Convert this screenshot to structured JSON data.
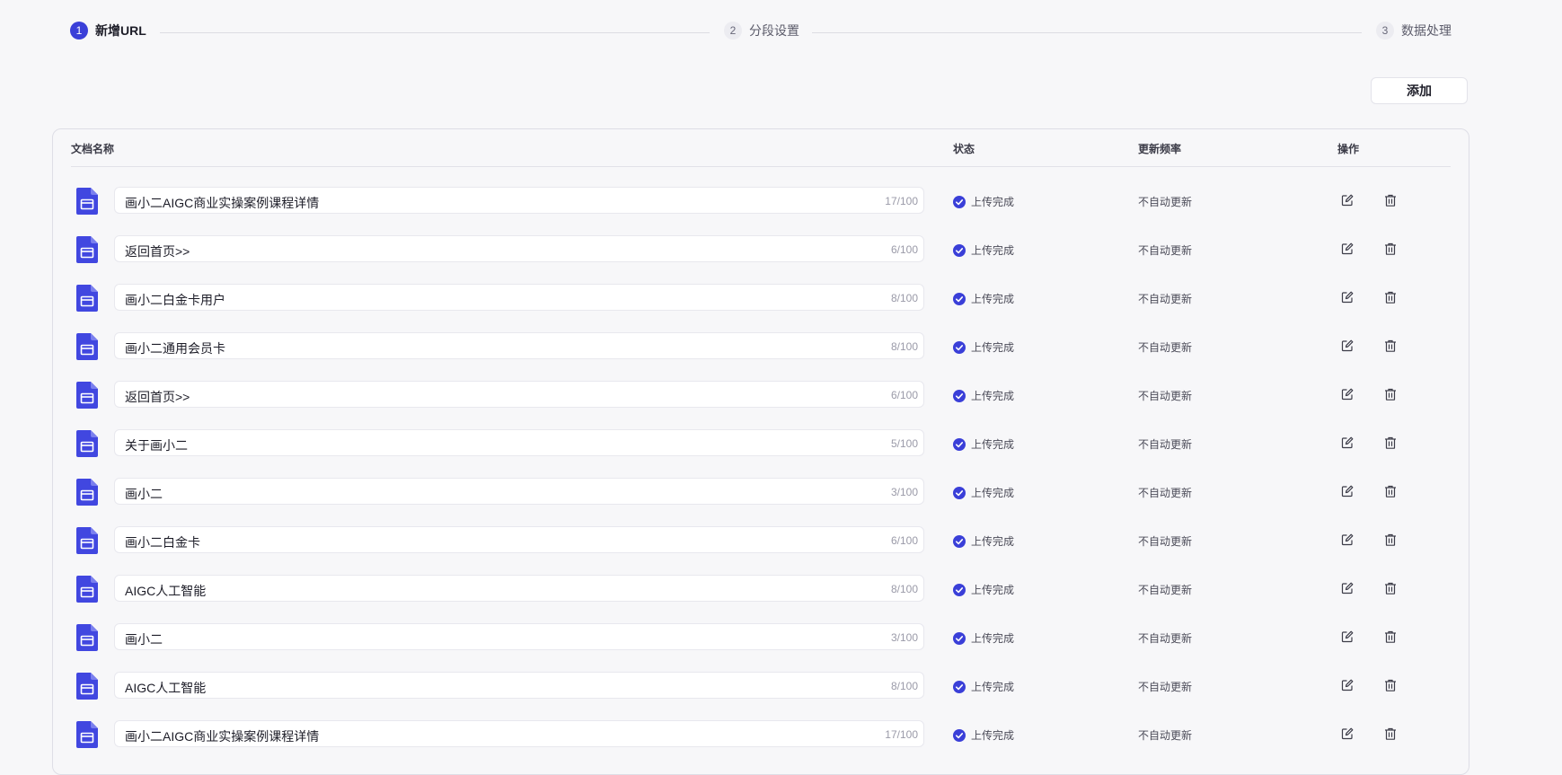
{
  "steps": [
    {
      "num": "1",
      "label": "新增URL"
    },
    {
      "num": "2",
      "label": "分段设置"
    },
    {
      "num": "3",
      "label": "数据处理"
    }
  ],
  "add_button": "添加",
  "table": {
    "headers": {
      "name": "文档名称",
      "status": "状态",
      "frequency": "更新频率",
      "actions": "操作"
    },
    "rows": [
      {
        "name": "画小二AIGC商业实操案例课程详情",
        "count": "17/100",
        "status": "上传完成",
        "frequency": "不自动更新"
      },
      {
        "name": "返回首页>>",
        "count": "6/100",
        "status": "上传完成",
        "frequency": "不自动更新"
      },
      {
        "name": "画小二白金卡用户",
        "count": "8/100",
        "status": "上传完成",
        "frequency": "不自动更新"
      },
      {
        "name": "画小二通用会员卡",
        "count": "8/100",
        "status": "上传完成",
        "frequency": "不自动更新"
      },
      {
        "name": "返回首页>>",
        "count": "6/100",
        "status": "上传完成",
        "frequency": "不自动更新"
      },
      {
        "name": "关于画小二",
        "count": "5/100",
        "status": "上传完成",
        "frequency": "不自动更新"
      },
      {
        "name": "画小二",
        "count": "3/100",
        "status": "上传完成",
        "frequency": "不自动更新"
      },
      {
        "name": "画小二白金卡",
        "count": "6/100",
        "status": "上传完成",
        "frequency": "不自动更新"
      },
      {
        "name": "AIGC人工智能",
        "count": "8/100",
        "status": "上传完成",
        "frequency": "不自动更新"
      },
      {
        "name": "画小二",
        "count": "3/100",
        "status": "上传完成",
        "frequency": "不自动更新"
      },
      {
        "name": "AIGC人工智能",
        "count": "8/100",
        "status": "上传完成",
        "frequency": "不自动更新"
      },
      {
        "name": "画小二AIGC商业实操案例课程详情",
        "count": "17/100",
        "status": "上传完成",
        "frequency": "不自动更新"
      }
    ]
  },
  "colors": {
    "accent": "#3a3fd8",
    "icon_blue": "#4147e0",
    "background": "#f7f7f9"
  },
  "icons": {
    "document": "document-icon",
    "status": "check-circle-icon",
    "edit": "edit-icon",
    "delete": "trash-icon"
  }
}
